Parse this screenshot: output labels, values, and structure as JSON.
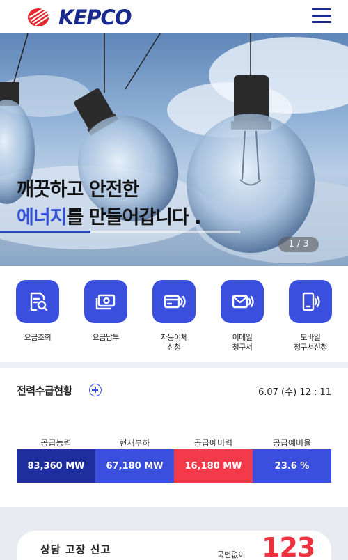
{
  "header": {
    "logo_text": "KEPCO",
    "logo_icon": "kepco-logo",
    "menu_icon": "hamburger-menu-icon"
  },
  "hero": {
    "line1": "깨끗하고 안전한",
    "line2_accent": "에너지",
    "line2_rest": "를 만들어갑니다 .",
    "pager": "1 / 3",
    "accent_color": "#3450d6"
  },
  "quick_services": [
    {
      "label": "요금조회",
      "icon": "bill-search-icon"
    },
    {
      "label": "요금납부",
      "icon": "payment-card-icon"
    },
    {
      "label": "자동이체\n신청",
      "icon": "auto-transfer-icon"
    },
    {
      "label": "이메일\n청구서",
      "icon": "email-bill-icon"
    },
    {
      "label": "모바일\n청구서신청",
      "icon": "mobile-bill-icon"
    }
  ],
  "power": {
    "title": "전력수급현황",
    "time": "6.07 (수) 12 : 11",
    "columns": [
      {
        "label": "공급능력",
        "value": "83,360 MW",
        "color": "#1f2e9e"
      },
      {
        "label": "현재부하",
        "value": "67,180 MW",
        "color": "#3b4fdf"
      },
      {
        "label": "공급예비력",
        "value": "16,180 MW",
        "color": "#f33a4b"
      },
      {
        "label": "공급예비율",
        "value": "23.6 %",
        "color": "#3b4fdf"
      }
    ]
  },
  "contact": {
    "title": "상담 고장 신고",
    "sub": "국번없이",
    "number": "123"
  }
}
